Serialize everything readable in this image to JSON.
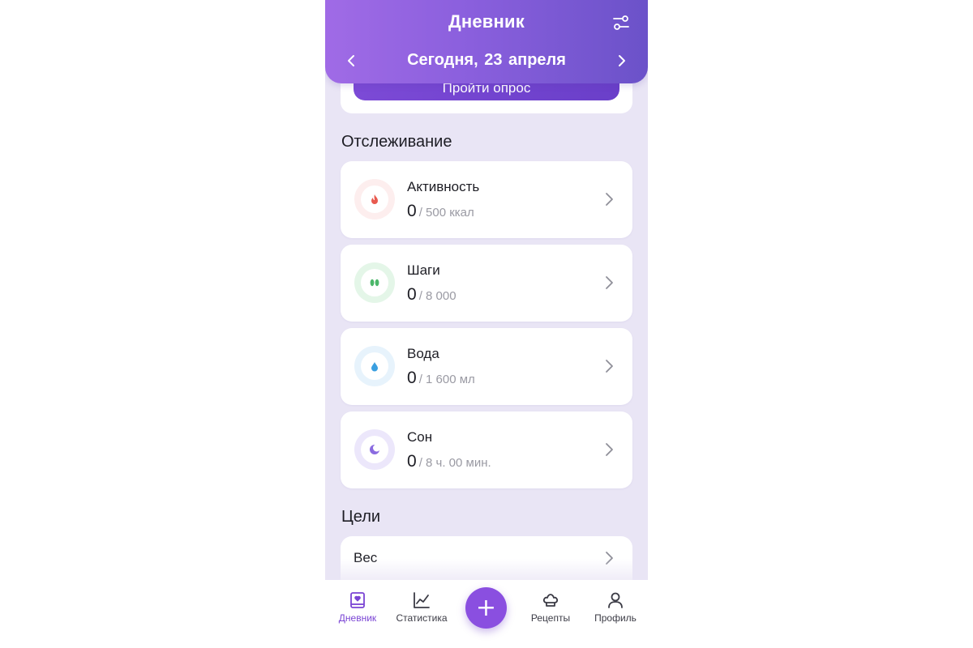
{
  "header": {
    "title": "Дневник",
    "date": "Сегодня,  23 апреля"
  },
  "survey": {
    "button_label": "Пройти опрос"
  },
  "tracking": {
    "section_title": "Отслеживание",
    "items": [
      {
        "name": "Активность",
        "value": "0",
        "goal": "/ 500 ккал",
        "icon": "fire-icon",
        "color": "#e85a4f",
        "ring": "#fdeeee"
      },
      {
        "name": "Шаги",
        "value": "0",
        "goal": "/ 8 000",
        "icon": "footsteps-icon",
        "color": "#4cb76a",
        "ring": "#e4f6e8"
      },
      {
        "name": "Вода",
        "value": "0",
        "goal": "/ 1 600 мл",
        "icon": "water-drop-icon",
        "color": "#3a9fe0",
        "ring": "#e7f3fc"
      },
      {
        "name": "Сон",
        "value": "0",
        "goal": "/ 8 ч. 00 мин.",
        "icon": "moon-icon",
        "color": "#8a6be0",
        "ring": "#ece7fb"
      }
    ]
  },
  "goals": {
    "section_title": "Цели",
    "items": [
      {
        "name": "Вес"
      }
    ]
  },
  "nav": {
    "items": [
      {
        "label": "Дневник",
        "icon": "diary-icon",
        "active": true
      },
      {
        "label": "Статистика",
        "icon": "chart-icon",
        "active": false
      },
      {
        "label": "Рецепты",
        "icon": "chef-hat-icon",
        "active": false
      },
      {
        "label": "Профиль",
        "icon": "profile-icon",
        "active": false
      }
    ],
    "add_label": "+"
  },
  "colors": {
    "accent": "#8a4fe0",
    "background": "#e9e5f5"
  }
}
